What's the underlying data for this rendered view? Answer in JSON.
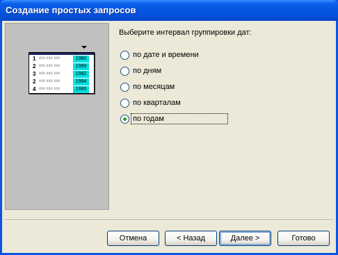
{
  "window": {
    "title": "Создание простых запросов"
  },
  "preview": {
    "rows": [
      {
        "num": "1",
        "filler": "xxx xxx xxx",
        "year": "1980"
      },
      {
        "num": "2",
        "filler": "xxx xxx xxx",
        "year": "1989"
      },
      {
        "num": "3",
        "filler": "xxx xxx xxx",
        "year": "1992"
      },
      {
        "num": "2",
        "filler": "xxx xxx xxx",
        "year": "1994"
      },
      {
        "num": "4",
        "filler": "xxx xxx xxx",
        "year": "1995"
      }
    ]
  },
  "question": "Выберите интервал группировки дат:",
  "options": [
    {
      "label": "по дате и времени",
      "checked": false
    },
    {
      "label": "по дням",
      "checked": false
    },
    {
      "label": "по месяцам",
      "checked": false
    },
    {
      "label": "по кварталам",
      "checked": false
    },
    {
      "label": "по годам",
      "checked": true
    }
  ],
  "buttons": {
    "cancel": "Отмена",
    "back": "< Назад",
    "next": "Далее >",
    "finish": "Готово"
  },
  "colors": {
    "title_bar": "#0552dc",
    "client_bg": "#ece9d8",
    "highlight_column": "#00e0e0",
    "radio_dot": "#21a121"
  }
}
